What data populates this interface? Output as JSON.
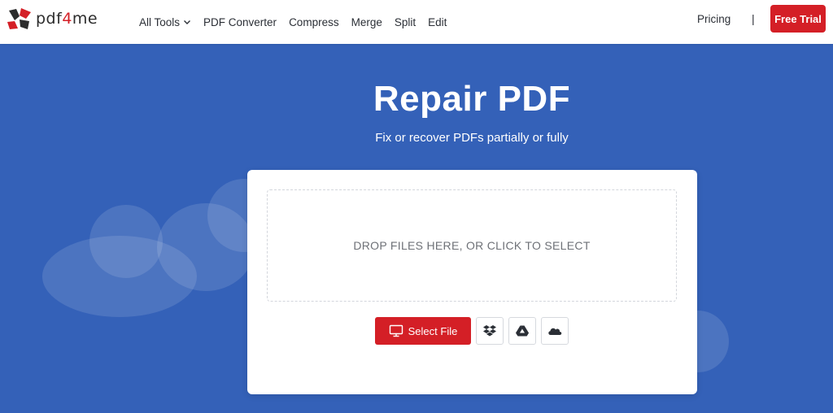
{
  "brand": {
    "logo_prefix": "pdf",
    "logo_highlight": "4",
    "logo_suffix": "me"
  },
  "nav": {
    "items": [
      {
        "label": "All Tools",
        "has_dropdown": true
      },
      {
        "label": "PDF Converter"
      },
      {
        "label": "Compress"
      },
      {
        "label": "Merge"
      },
      {
        "label": "Split"
      },
      {
        "label": "Edit"
      }
    ],
    "pricing_label": "Pricing",
    "separator": "|",
    "trial_label": "Free Trial"
  },
  "hero": {
    "title": "Repair PDF",
    "subtitle": "Fix or recover PDFs partially or fully"
  },
  "upload": {
    "dropzone_text": "DROP FILES HERE, OR CLICK TO SELECT",
    "select_label": "Select File",
    "sources": [
      "dropbox-icon",
      "google-drive-icon",
      "onedrive-icon"
    ]
  },
  "colors": {
    "accent": "#d41f26",
    "background": "#3461b8",
    "header": "#ffffff"
  }
}
